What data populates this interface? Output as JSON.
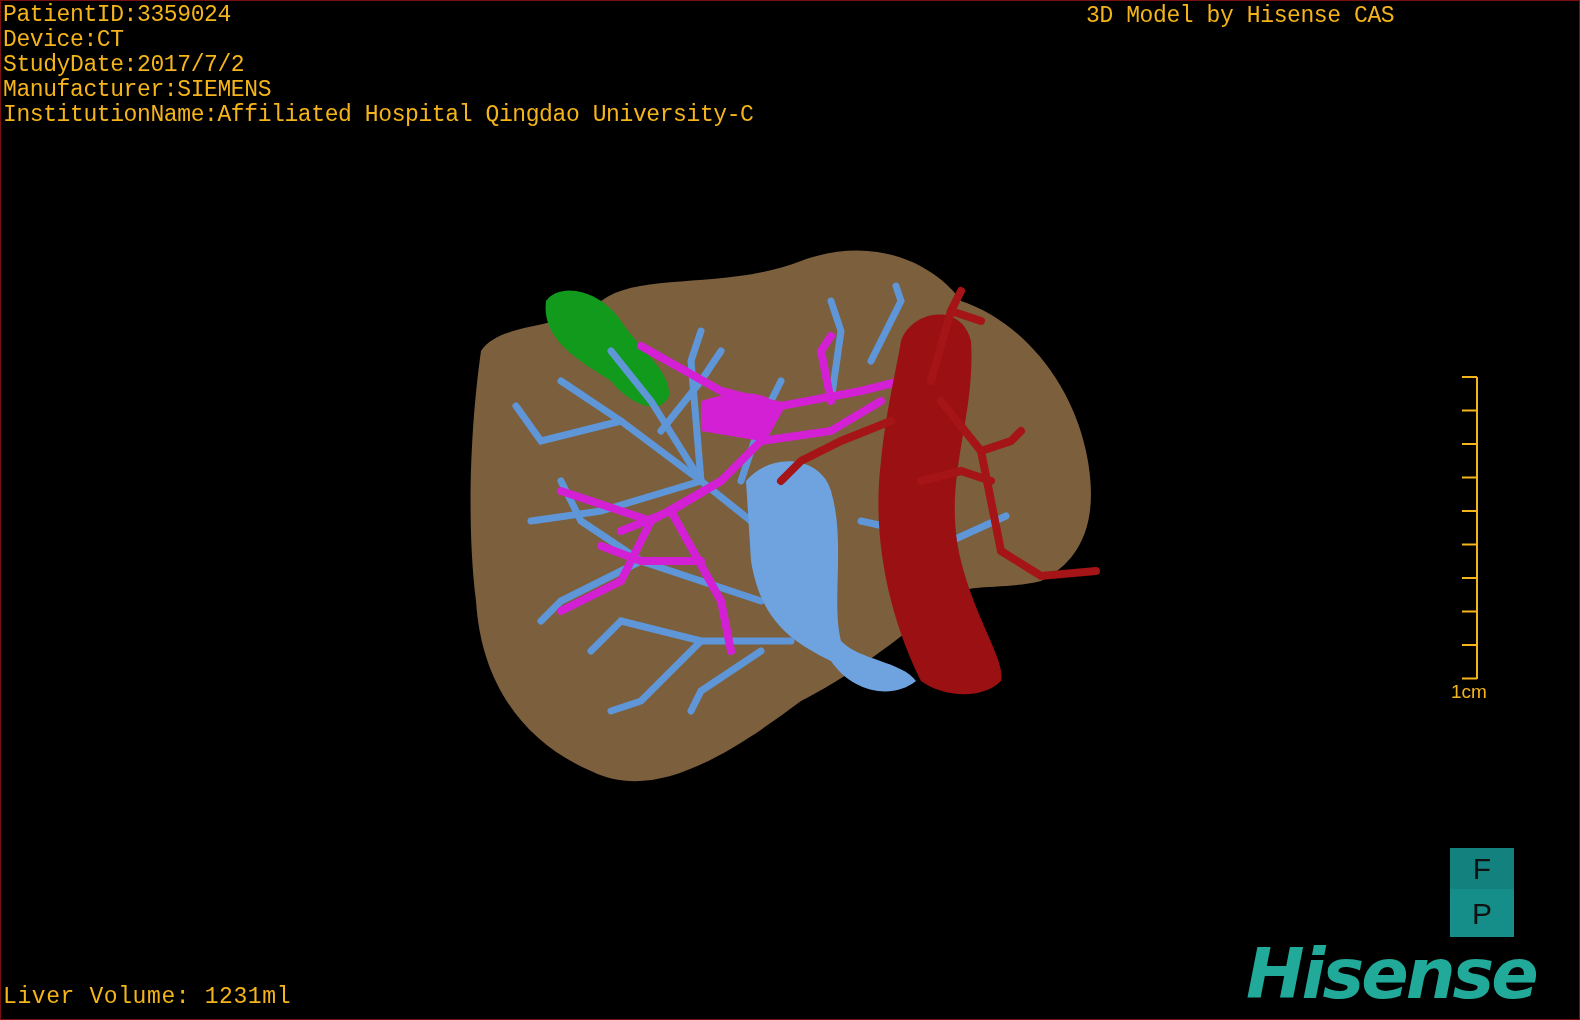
{
  "patient_info": [
    "PatientID:3359024",
    "Device:CT",
    "StudyDate:2017/7/2",
    "Manufacturer:SIEMENS",
    "InstitutionName:Affiliated Hospital Qingdao University-C"
  ],
  "title": "3D Model by Hisense CAS",
  "scale_bar": {
    "label": "1cm"
  },
  "orientation_buttons": [
    "F",
    "P"
  ],
  "logo": "Hisense",
  "liver_volume": "Liver Volume: 1231ml"
}
